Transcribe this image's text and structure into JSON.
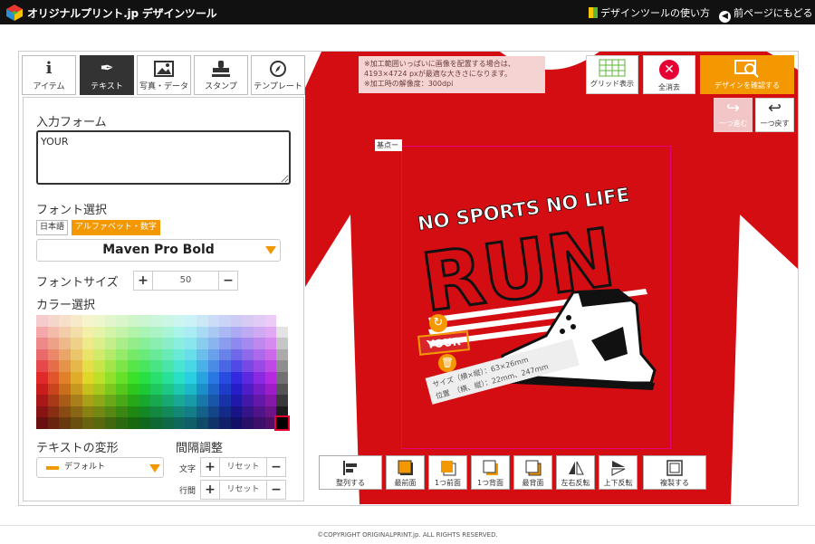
{
  "header": {
    "brand": "オリジナルプリント.jp デザインツール",
    "help_link": "デザインツールの使い方",
    "back_link": "前ページにもどる"
  },
  "tabs": [
    {
      "label": "アイテム",
      "icon": "info-icon"
    },
    {
      "label": "テキスト",
      "icon": "pen-icon"
    },
    {
      "label": "写真・データ",
      "icon": "image-icon"
    },
    {
      "label": "スタンプ",
      "icon": "stamp-icon"
    },
    {
      "label": "テンプレート",
      "icon": "compass-icon"
    }
  ],
  "panel": {
    "input_label": "入力フォーム",
    "input_value": "YOUR",
    "font_label": "フォント選択",
    "lang_japanese": "日本語",
    "lang_alnum": "アルファベット・数字",
    "font_value": "Maven Pro Bold",
    "size_label": "フォントサイズ",
    "size_value": "50",
    "color_label": "カラー選択",
    "transform_label": "テキストの変形",
    "transform_value": "デフォルト",
    "spacing_label": "間隔調整",
    "char_label": "文字",
    "line_label": "行間",
    "reset": "リセット"
  },
  "canvas": {
    "note_lines": [
      "※加工範囲いっぱいに画像を配置する場合は、",
      "4193×4724 pxが最適な大きさになります。",
      "※加工時の解像度：300dpi"
    ],
    "base_label": "基点ー",
    "design_top": "NO SPORTS NO LIFE",
    "design_main": "RUN",
    "text_object": "YOUR",
    "size_info": "サイズ（横×縦）：63×26mm",
    "position_info": "位置　（横、縦）：22mm、247mm",
    "shirt_color": "#d40d12",
    "accent": "#f39800"
  },
  "toolbar": {
    "grid": "グリッド表示",
    "clear": "全消去",
    "confirm": "デザインを確認する",
    "redo": "一つ進む",
    "undo": "一つ戻す"
  },
  "bottom": [
    "整列する",
    "最前面",
    "1つ前面",
    "1つ背面",
    "最背面",
    "左右反転",
    "上下反転",
    "複製する"
  ],
  "footer": "©COPYRIGHT ORIGINALPRINT.jp. ALL RIGHTS RESERVED."
}
